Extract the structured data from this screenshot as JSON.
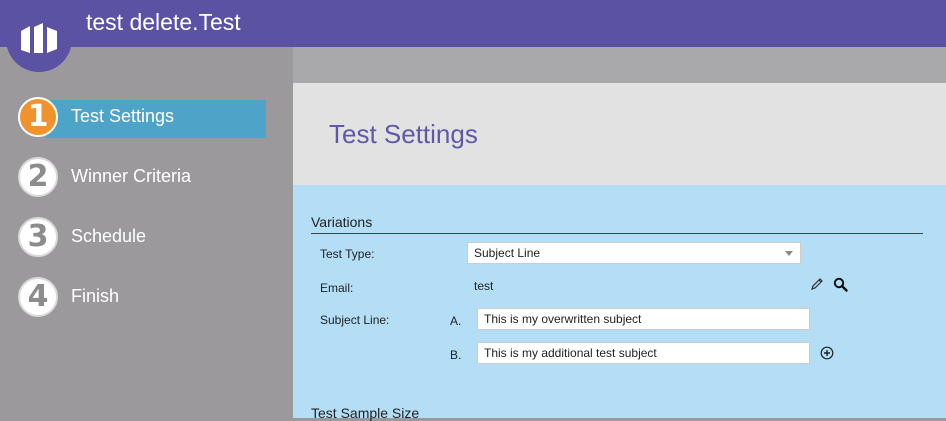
{
  "app": {
    "title": "test delete.Test"
  },
  "sidebar": {
    "steps": [
      {
        "number": "1",
        "label": "Test Settings",
        "active": true
      },
      {
        "number": "2",
        "label": "Winner Criteria",
        "active": false
      },
      {
        "number": "3",
        "label": "Schedule",
        "active": false
      },
      {
        "number": "4",
        "label": "Finish",
        "active": false
      }
    ]
  },
  "main": {
    "heading": "Test Settings",
    "variations": {
      "section_title": "Variations",
      "test_type_label": "Test Type:",
      "test_type_value": "Subject Line",
      "email_label": "Email:",
      "email_value": "test",
      "subject_line_label": "Subject Line:",
      "subject_a_letter": "A.",
      "subject_a_value": "This is my overwritten subject",
      "subject_b_letter": "B.",
      "subject_b_value": "This is my additional test subject"
    },
    "sample_size": {
      "section_title": "Test Sample Size"
    }
  },
  "colors": {
    "topbar": "#5b52a3",
    "active_step": "#4ea4c8",
    "active_circle": "#f0932d",
    "content_bg": "#b3def6",
    "heading": "#5e59a7"
  },
  "icons": [
    "marketo-logo-icon",
    "pencil-icon",
    "search-icon",
    "add-circle-icon",
    "chevron-down-icon"
  ]
}
